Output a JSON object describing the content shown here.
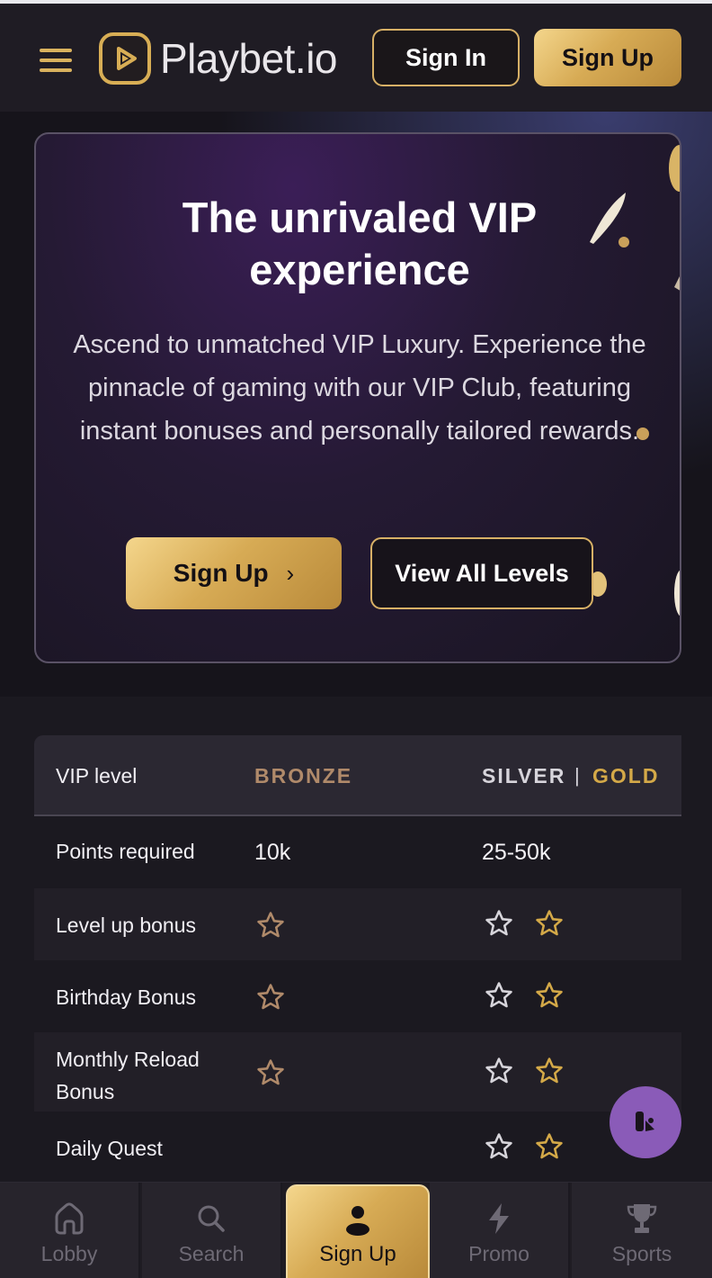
{
  "header": {
    "brand": "Playbet.io",
    "sign_in": "Sign In",
    "sign_up": "Sign Up"
  },
  "hero": {
    "title": "The unrivaled VIP experience",
    "description": "Ascend to unmatched VIP Luxury. Experience the pinnacle of gaming with our VIP Club, featuring instant bonuses and personally tailored rewards.",
    "sign_up": "Sign Up",
    "view_levels": "View All Levels"
  },
  "table": {
    "header": {
      "label": "VIP level",
      "bronze": "BRONZE",
      "silver": "SILVER",
      "separator": "|",
      "gold": "GOLD"
    },
    "rows": [
      {
        "label": "Points required",
        "bronze": "10k",
        "silver_gold": "25-50k"
      },
      {
        "label": "Level up bonus"
      },
      {
        "label": "Birthday Bonus"
      },
      {
        "label": "Monthly Reload Bonus"
      },
      {
        "label": "Daily Quest"
      }
    ]
  },
  "bottom_nav": {
    "items": [
      {
        "label": "Lobby",
        "icon": "home-icon"
      },
      {
        "label": "Search",
        "icon": "search-icon"
      },
      {
        "label": "Sign Up",
        "icon": "user-icon"
      },
      {
        "label": "Promo",
        "icon": "lightning-icon"
      },
      {
        "label": "Sports",
        "icon": "trophy-icon"
      }
    ]
  },
  "colors": {
    "gold": "#d7ab55",
    "bronze": "#b08a6a",
    "silver": "#d7d5db",
    "background": "#1b1920",
    "fab": "#8a5bb8"
  }
}
